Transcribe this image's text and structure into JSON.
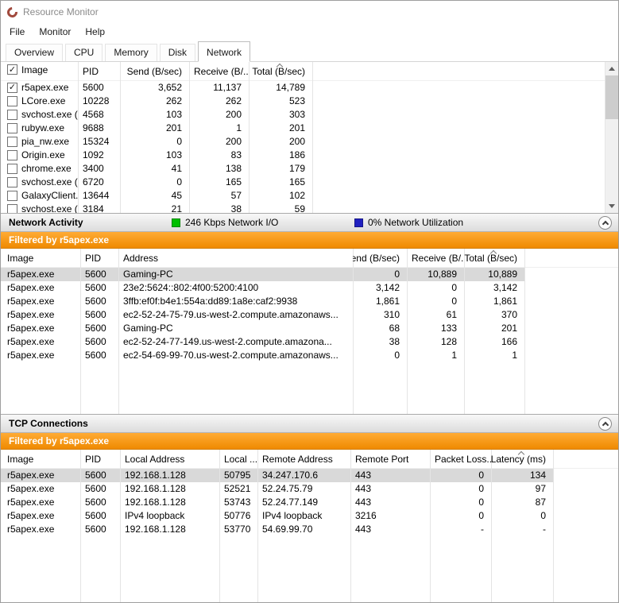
{
  "window": {
    "title": "Resource Monitor"
  },
  "menu": {
    "items": [
      {
        "label": "File"
      },
      {
        "label": "Monitor"
      },
      {
        "label": "Help"
      }
    ]
  },
  "tabs": {
    "items": [
      {
        "label": "Overview"
      },
      {
        "label": "CPU"
      },
      {
        "label": "Memory"
      },
      {
        "label": "Disk"
      },
      {
        "label": "Network",
        "active": "true"
      }
    ]
  },
  "processes": {
    "headers": {
      "image": "Image",
      "pid": "PID",
      "send": "Send (B/sec)",
      "receive": "Receive (B/...",
      "total": "Total (B/sec)"
    },
    "select_all_checked": "true",
    "rows": [
      {
        "checked": "true",
        "image": "r5apex.exe",
        "pid": "5600",
        "send": "3,652",
        "receive": "11,137",
        "total": "14,789"
      },
      {
        "checked": "false",
        "image": "LCore.exe",
        "pid": "10228",
        "send": "262",
        "receive": "262",
        "total": "523"
      },
      {
        "checked": "false",
        "image": "svchost.exe (...",
        "pid": "4568",
        "send": "103",
        "receive": "200",
        "total": "303"
      },
      {
        "checked": "false",
        "image": "rubyw.exe",
        "pid": "9688",
        "send": "201",
        "receive": "1",
        "total": "201"
      },
      {
        "checked": "false",
        "image": "pia_nw.exe",
        "pid": "15324",
        "send": "0",
        "receive": "200",
        "total": "200"
      },
      {
        "checked": "false",
        "image": "Origin.exe",
        "pid": "1092",
        "send": "103",
        "receive": "83",
        "total": "186"
      },
      {
        "checked": "false",
        "image": "chrome.exe",
        "pid": "3400",
        "send": "41",
        "receive": "138",
        "total": "179"
      },
      {
        "checked": "false",
        "image": "svchost.exe (...",
        "pid": "6720",
        "send": "0",
        "receive": "165",
        "total": "165"
      },
      {
        "checked": "false",
        "image": "GalaxyClient...",
        "pid": "13644",
        "send": "45",
        "receive": "57",
        "total": "102"
      },
      {
        "checked": "false",
        "image": "svchost.exe (...",
        "pid": "3184",
        "send": "21",
        "receive": "38",
        "total": "59"
      }
    ]
  },
  "network_activity": {
    "title": "Network Activity",
    "legend": [
      {
        "label": "246 Kbps Network I/O",
        "color": "#00c000"
      },
      {
        "label": "0% Network Utilization",
        "color": "#2020c0"
      }
    ],
    "filter": "Filtered by r5apex.exe",
    "headers": {
      "image": "Image",
      "pid": "PID",
      "address": "Address",
      "send": "Send (B/sec)",
      "receive": "Receive (B/...",
      "total": "Total (B/sec)"
    },
    "rows": [
      {
        "state": "selected",
        "image": "r5apex.exe",
        "pid": "5600",
        "address": "Gaming-PC",
        "send": "0",
        "receive": "10,889",
        "total": "10,889"
      },
      {
        "state": "normal",
        "image": "r5apex.exe",
        "pid": "5600",
        "address": "23e2:5624::802:4f00:5200:4100",
        "send": "3,142",
        "receive": "0",
        "total": "3,142"
      },
      {
        "state": "normal",
        "image": "r5apex.exe",
        "pid": "5600",
        "address": "3ffb:ef0f:b4e1:554a:dd89:1a8e:caf2:9938",
        "send": "1,861",
        "receive": "0",
        "total": "1,861"
      },
      {
        "state": "normal",
        "image": "r5apex.exe",
        "pid": "5600",
        "address": "ec2-52-24-75-79.us-west-2.compute.amazonaws...",
        "send": "310",
        "receive": "61",
        "total": "370"
      },
      {
        "state": "normal",
        "image": "r5apex.exe",
        "pid": "5600",
        "address": "Gaming-PC",
        "send": "68",
        "receive": "133",
        "total": "201"
      },
      {
        "state": "normal",
        "image": "r5apex.exe",
        "pid": "5600",
        "address": "ec2-52-24-77-149.us-west-2.compute.amazona...",
        "send": "38",
        "receive": "128",
        "total": "166"
      },
      {
        "state": "normal",
        "image": "r5apex.exe",
        "pid": "5600",
        "address": "ec2-54-69-99-70.us-west-2.compute.amazonaws...",
        "send": "0",
        "receive": "1",
        "total": "1"
      }
    ]
  },
  "tcp_connections": {
    "title": "TCP Connections",
    "filter": "Filtered by r5apex.exe",
    "headers": {
      "image": "Image",
      "pid": "PID",
      "local_address": "Local Address",
      "local_port": "Local ...",
      "remote_address": "Remote Address",
      "remote_port": "Remote Port",
      "packet_loss": "Packet Loss...",
      "latency": "Latency (ms)"
    },
    "rows": [
      {
        "state": "selected",
        "image": "r5apex.exe",
        "pid": "5600",
        "local_address": "192.168.1.128",
        "local_port": "50795",
        "remote_address": "34.247.170.6",
        "remote_port": "443",
        "packet_loss": "0",
        "latency": "134"
      },
      {
        "state": "normal",
        "image": "r5apex.exe",
        "pid": "5600",
        "local_address": "192.168.1.128",
        "local_port": "52521",
        "remote_address": "52.24.75.79",
        "remote_port": "443",
        "packet_loss": "0",
        "latency": "97"
      },
      {
        "state": "normal",
        "image": "r5apex.exe",
        "pid": "5600",
        "local_address": "192.168.1.128",
        "local_port": "53743",
        "remote_address": "52.24.77.149",
        "remote_port": "443",
        "packet_loss": "0",
        "latency": "87"
      },
      {
        "state": "normal",
        "image": "r5apex.exe",
        "pid": "5600",
        "local_address": "IPv4 loopback",
        "local_port": "50776",
        "remote_address": "IPv4 loopback",
        "remote_port": "3216",
        "packet_loss": "0",
        "latency": "0"
      },
      {
        "state": "normal",
        "image": "r5apex.exe",
        "pid": "5600",
        "local_address": "192.168.1.128",
        "local_port": "53770",
        "remote_address": "54.69.99.70",
        "remote_port": "443",
        "packet_loss": "-",
        "latency": "-"
      }
    ]
  }
}
